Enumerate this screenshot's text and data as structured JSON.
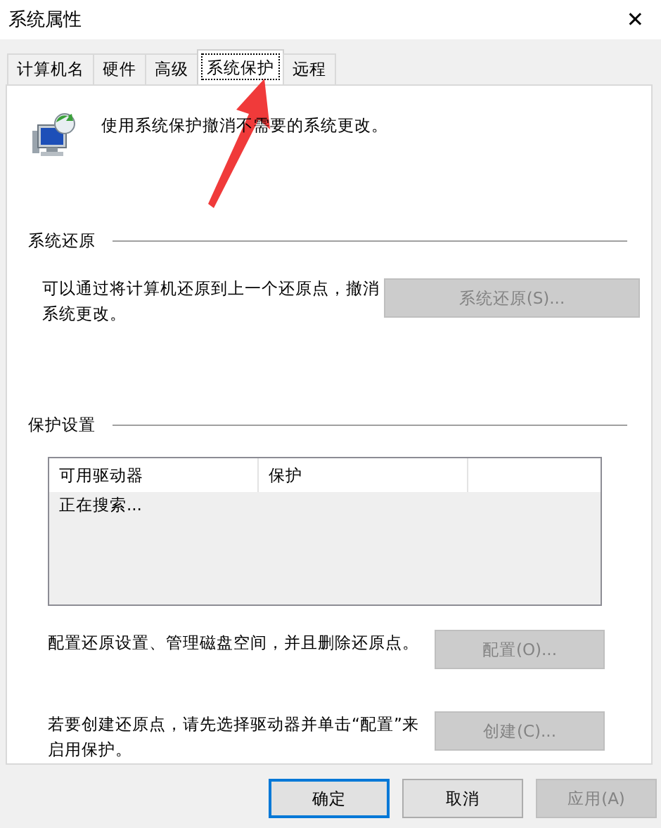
{
  "window": {
    "title": "系统属性",
    "close": "✕"
  },
  "tabs": [
    {
      "label": "计算机名",
      "selected": false
    },
    {
      "label": "硬件",
      "selected": false
    },
    {
      "label": "高级",
      "selected": false
    },
    {
      "label": "系统保护",
      "selected": true
    },
    {
      "label": "远程",
      "selected": false
    }
  ],
  "intro": "使用系统保护撤消不需要的系统更改。",
  "restore": {
    "heading": "系统还原",
    "text": "可以通过将计算机还原到上一个还原点，撤消系统更改。",
    "button": {
      "label": "系统还原(S)...",
      "disabled": true
    }
  },
  "protection": {
    "heading": "保护设置",
    "table": {
      "columns": [
        "可用驱动器",
        "保护"
      ],
      "rows": [
        [
          "正在搜索..."
        ]
      ]
    },
    "actions": [
      {
        "text": "配置还原设置、管理磁盘空间，并且删除还原点。",
        "button": {
          "label": "配置(O)...",
          "disabled": true
        }
      },
      {
        "text": "若要创建还原点，请先选择驱动器并单击“配置”来启用保护。",
        "button": {
          "label": "创建(C)...",
          "disabled": true
        }
      }
    ]
  },
  "buttons": [
    {
      "label": "确定",
      "default": true,
      "disabled": false
    },
    {
      "label": "取消",
      "default": false,
      "disabled": false
    },
    {
      "label": "应用(A)",
      "default": false,
      "disabled": true
    }
  ]
}
